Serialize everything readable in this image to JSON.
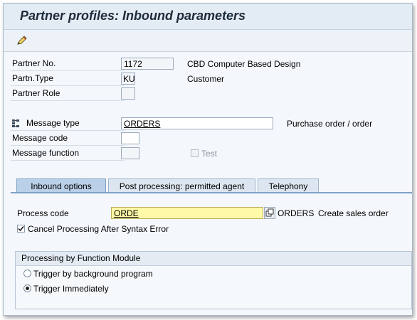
{
  "title": "Partner profiles: Inbound parameters",
  "toolbar": {
    "icon": "edit-pencil-icon"
  },
  "header": {
    "partner_no": {
      "label": "Partner No.",
      "value": "1172",
      "description": "CBD Computer Based Design"
    },
    "partn_type": {
      "label": "Partn.Type",
      "value": "KU",
      "description": "Customer"
    },
    "partner_role": {
      "label": "Partner Role",
      "value": ""
    }
  },
  "message": {
    "type": {
      "label": "Message type",
      "value": "ORDERS",
      "description": "Purchase order / order"
    },
    "code": {
      "label": "Message code",
      "value": ""
    },
    "function": {
      "label": "Message function",
      "value": ""
    },
    "test": {
      "label": "Test",
      "checked": false,
      "disabled": true
    }
  },
  "tabs": [
    {
      "label": "Inbound options",
      "active": true
    },
    {
      "label": "Post processing: permitted agent",
      "active": false
    },
    {
      "label": "Telephony",
      "active": false
    }
  ],
  "inbound": {
    "process_code": {
      "label": "Process code",
      "value": "ORDE",
      "description_code": "ORDERS",
      "description": "Create sales order"
    },
    "cancel_after_syntax_error": {
      "label": "Cancel Processing After Syntax Error",
      "checked": true
    },
    "processing_group": {
      "title": "Processing by Function Module",
      "options": [
        {
          "label": "Trigger by background program",
          "selected": false
        },
        {
          "label": "Trigger Immediately",
          "selected": true
        }
      ]
    }
  },
  "colors": {
    "accent": "#7ea3c7",
    "title_bg": "#e3ebf4",
    "highlight_field": "#fff9a8"
  }
}
